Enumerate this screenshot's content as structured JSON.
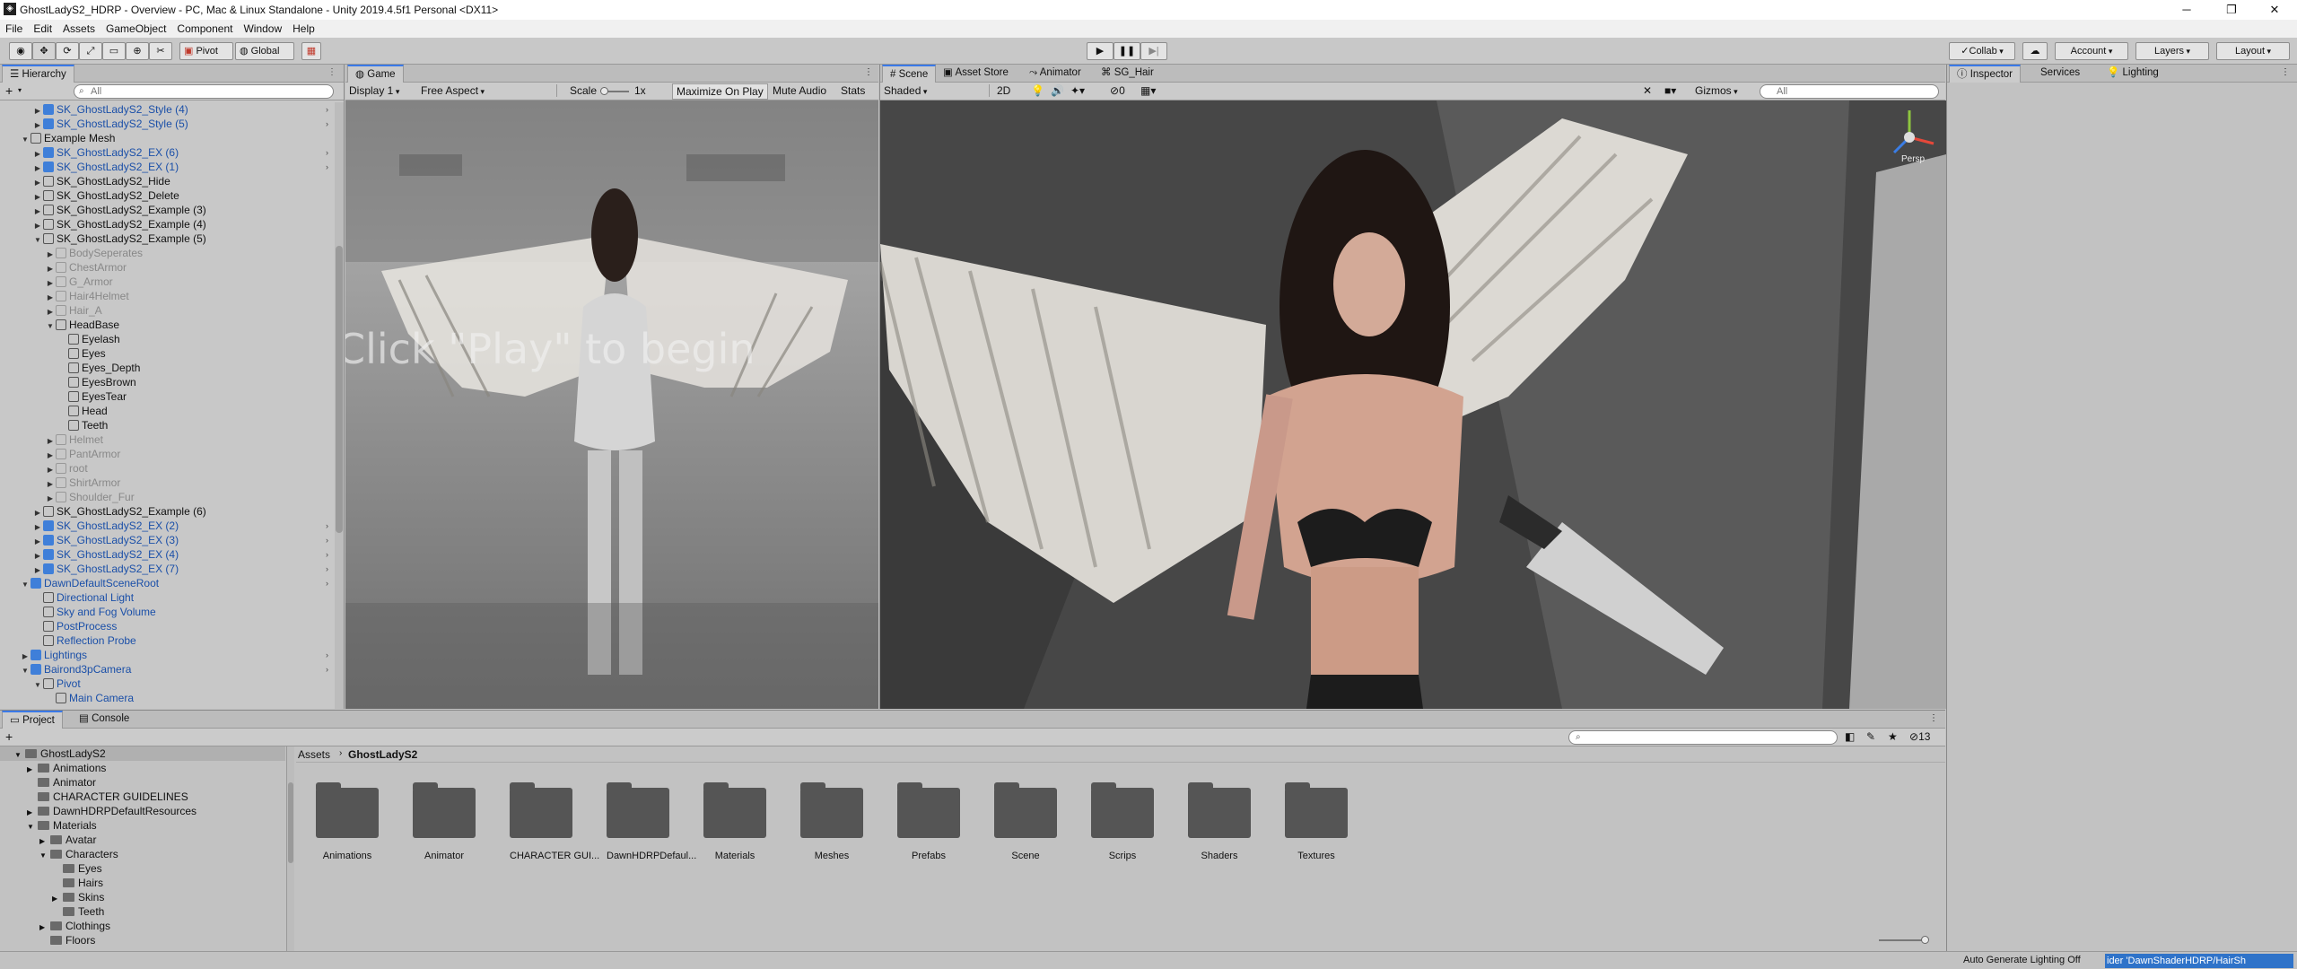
{
  "window": {
    "title": "GhostLadyS2_HDRP - Overview - PC, Mac & Linux Standalone - Unity 2019.4.5f1 Personal <DX11>",
    "minimize": "─",
    "maximize": "❐",
    "close": "✕"
  },
  "menu": [
    "File",
    "Edit",
    "Assets",
    "GameObject",
    "Component",
    "Window",
    "Help"
  ],
  "toolbar": {
    "pivot": "Pivot",
    "global": "Global",
    "collab": "Collab",
    "account": "Account",
    "layers": "Layers",
    "layout": "Layout"
  },
  "hierarchy": {
    "tab": "Hierarchy",
    "search_placeholder": "All",
    "add": "+",
    "rows": [
      {
        "t": "SK_GhostLadyS2_Style (4)",
        "lvl": 3,
        "c": "blue",
        "a": "▶",
        "r": true
      },
      {
        "t": "SK_GhostLadyS2_Style (5)",
        "lvl": 3,
        "c": "blue",
        "a": "▶",
        "r": true
      },
      {
        "t": "Example Mesh",
        "lvl": 2,
        "c": "go",
        "a": "▼",
        "r": false
      },
      {
        "t": "SK_GhostLadyS2_EX (6)",
        "lvl": 3,
        "c": "blue",
        "a": "▶",
        "r": true
      },
      {
        "t": "SK_GhostLadyS2_EX (1)",
        "lvl": 3,
        "c": "blue",
        "a": "▶",
        "r": true
      },
      {
        "t": "SK_GhostLadyS2_Hide",
        "lvl": 3,
        "c": "black",
        "a": "▶",
        "r": false
      },
      {
        "t": "SK_GhostLadyS2_Delete",
        "lvl": 3,
        "c": "black",
        "a": "▶",
        "r": false
      },
      {
        "t": "SK_GhostLadyS2_Example (3)",
        "lvl": 3,
        "c": "black",
        "a": "▶",
        "r": false
      },
      {
        "t": "SK_GhostLadyS2_Example (4)",
        "lvl": 3,
        "c": "black",
        "a": "▶",
        "r": false
      },
      {
        "t": "SK_GhostLadyS2_Example (5)",
        "lvl": 3,
        "c": "black",
        "a": "▼",
        "r": false
      },
      {
        "t": "BodySeperates",
        "lvl": 4,
        "c": "dim",
        "a": "▶",
        "r": false
      },
      {
        "t": "ChestArmor",
        "lvl": 4,
        "c": "dim",
        "a": "▶",
        "r": false
      },
      {
        "t": "G_Armor",
        "lvl": 4,
        "c": "dim",
        "a": "▶",
        "r": false
      },
      {
        "t": "Hair4Helmet",
        "lvl": 4,
        "c": "dim",
        "a": "▶",
        "r": false
      },
      {
        "t": "Hair_A",
        "lvl": 4,
        "c": "dim",
        "a": "▶",
        "r": false
      },
      {
        "t": "HeadBase",
        "lvl": 4,
        "c": "go",
        "a": "▼",
        "r": false
      },
      {
        "t": "Eyelash",
        "lvl": 5,
        "c": "go",
        "a": "",
        "r": false
      },
      {
        "t": "Eyes",
        "lvl": 5,
        "c": "go",
        "a": "",
        "r": false
      },
      {
        "t": "Eyes_Depth",
        "lvl": 5,
        "c": "go",
        "a": "",
        "r": false
      },
      {
        "t": "EyesBrown",
        "lvl": 5,
        "c": "go",
        "a": "",
        "r": false
      },
      {
        "t": "EyesTear",
        "lvl": 5,
        "c": "go",
        "a": "",
        "r": false
      },
      {
        "t": "Head",
        "lvl": 5,
        "c": "go",
        "a": "",
        "r": false
      },
      {
        "t": "Teeth",
        "lvl": 5,
        "c": "go",
        "a": "",
        "r": false
      },
      {
        "t": "Helmet",
        "lvl": 4,
        "c": "dim",
        "a": "▶",
        "r": false
      },
      {
        "t": "PantArmor",
        "lvl": 4,
        "c": "dim",
        "a": "▶",
        "r": false
      },
      {
        "t": "root",
        "lvl": 4,
        "c": "dim",
        "a": "▶",
        "r": false
      },
      {
        "t": "ShirtArmor",
        "lvl": 4,
        "c": "dim",
        "a": "▶",
        "r": false
      },
      {
        "t": "Shoulder_Fur",
        "lvl": 4,
        "c": "dim",
        "a": "▶",
        "r": false
      },
      {
        "t": "SK_GhostLadyS2_Example (6)",
        "lvl": 3,
        "c": "black",
        "a": "▶",
        "r": false
      },
      {
        "t": "SK_GhostLadyS2_EX (2)",
        "lvl": 3,
        "c": "blue",
        "a": "▶",
        "r": true
      },
      {
        "t": "SK_GhostLadyS2_EX (3)",
        "lvl": 3,
        "c": "blue",
        "a": "▶",
        "r": true
      },
      {
        "t": "SK_GhostLadyS2_EX (4)",
        "lvl": 3,
        "c": "blue",
        "a": "▶",
        "r": true
      },
      {
        "t": "SK_GhostLadyS2_EX (7)",
        "lvl": 3,
        "c": "blue",
        "a": "▶",
        "r": true
      },
      {
        "t": "DawnDefaultSceneRoot",
        "lvl": 2,
        "c": "blue",
        "a": "▼",
        "r": true
      },
      {
        "t": "Directional Light",
        "lvl": 3,
        "c": "bluego",
        "a": "",
        "r": false
      },
      {
        "t": "Sky and Fog Volume",
        "lvl": 3,
        "c": "bluego",
        "a": "",
        "r": false
      },
      {
        "t": "PostProcess",
        "lvl": 3,
        "c": "bluego",
        "a": "",
        "r": false
      },
      {
        "t": "Reflection Probe",
        "lvl": 3,
        "c": "bluego",
        "a": "",
        "r": false
      },
      {
        "t": "Lightings",
        "lvl": 2,
        "c": "blue",
        "a": "▶",
        "r": true
      },
      {
        "t": "Bairond3pCamera",
        "lvl": 2,
        "c": "blue",
        "a": "▼",
        "r": true
      },
      {
        "t": "Pivot",
        "lvl": 3,
        "c": "bluego",
        "a": "▼",
        "r": false
      },
      {
        "t": "Main Camera",
        "lvl": 4,
        "c": "bluego",
        "a": "",
        "r": false
      }
    ]
  },
  "game": {
    "tab": "Game",
    "display": "Display 1",
    "aspect": "Free Aspect",
    "scale_label": "Scale",
    "scale_value": "1x",
    "maximize": "Maximize On Play",
    "mute": "Mute Audio",
    "stats": "Stats",
    "overlay": "Click \"Play\" to begin"
  },
  "scene": {
    "tabs": [
      "Scene",
      "Asset Store",
      "Animator",
      "SG_Hair"
    ],
    "shading": "Shaded",
    "mode2d": "2D",
    "fx_count": "0",
    "gizmos": "Gizmos",
    "search_placeholder": "All",
    "persp": "Persp"
  },
  "inspector": {
    "tabs": [
      "Inspector",
      "Services",
      "Lighting"
    ]
  },
  "project": {
    "tabs": [
      "Project",
      "Console"
    ],
    "add": "+",
    "hidden_count": "13",
    "breadcrumb": [
      "Assets",
      "GhostLadyS2"
    ],
    "tree": [
      {
        "t": "GhostLadyS2",
        "lvl": 0,
        "a": "▼"
      },
      {
        "t": "Animations",
        "lvl": 1,
        "a": "▶"
      },
      {
        "t": "Animator",
        "lvl": 1,
        "a": ""
      },
      {
        "t": "CHARACTER GUIDELINES",
        "lvl": 1,
        "a": ""
      },
      {
        "t": "DawnHDRPDefaultResources",
        "lvl": 1,
        "a": "▶"
      },
      {
        "t": "Materials",
        "lvl": 1,
        "a": "▼"
      },
      {
        "t": "Avatar",
        "lvl": 2,
        "a": "▶"
      },
      {
        "t": "Characters",
        "lvl": 2,
        "a": "▼"
      },
      {
        "t": "Eyes",
        "lvl": 3,
        "a": ""
      },
      {
        "t": "Hairs",
        "lvl": 3,
        "a": ""
      },
      {
        "t": "Skins",
        "lvl": 3,
        "a": "▶"
      },
      {
        "t": "Teeth",
        "lvl": 3,
        "a": ""
      },
      {
        "t": "Clothings",
        "lvl": 2,
        "a": "▶"
      },
      {
        "t": "Floors",
        "lvl": 2,
        "a": ""
      }
    ],
    "folders": [
      "Animations",
      "Animator",
      "CHARACTER GUI...",
      "DawnHDRPDefaul...",
      "Materials",
      "Meshes",
      "Prefabs",
      "Scene",
      "Scrips",
      "Shaders",
      "Textures"
    ]
  },
  "status": {
    "lighting": "Auto Generate Lighting Off",
    "message": "ider 'DawnShaderHDRP/HairSh"
  }
}
